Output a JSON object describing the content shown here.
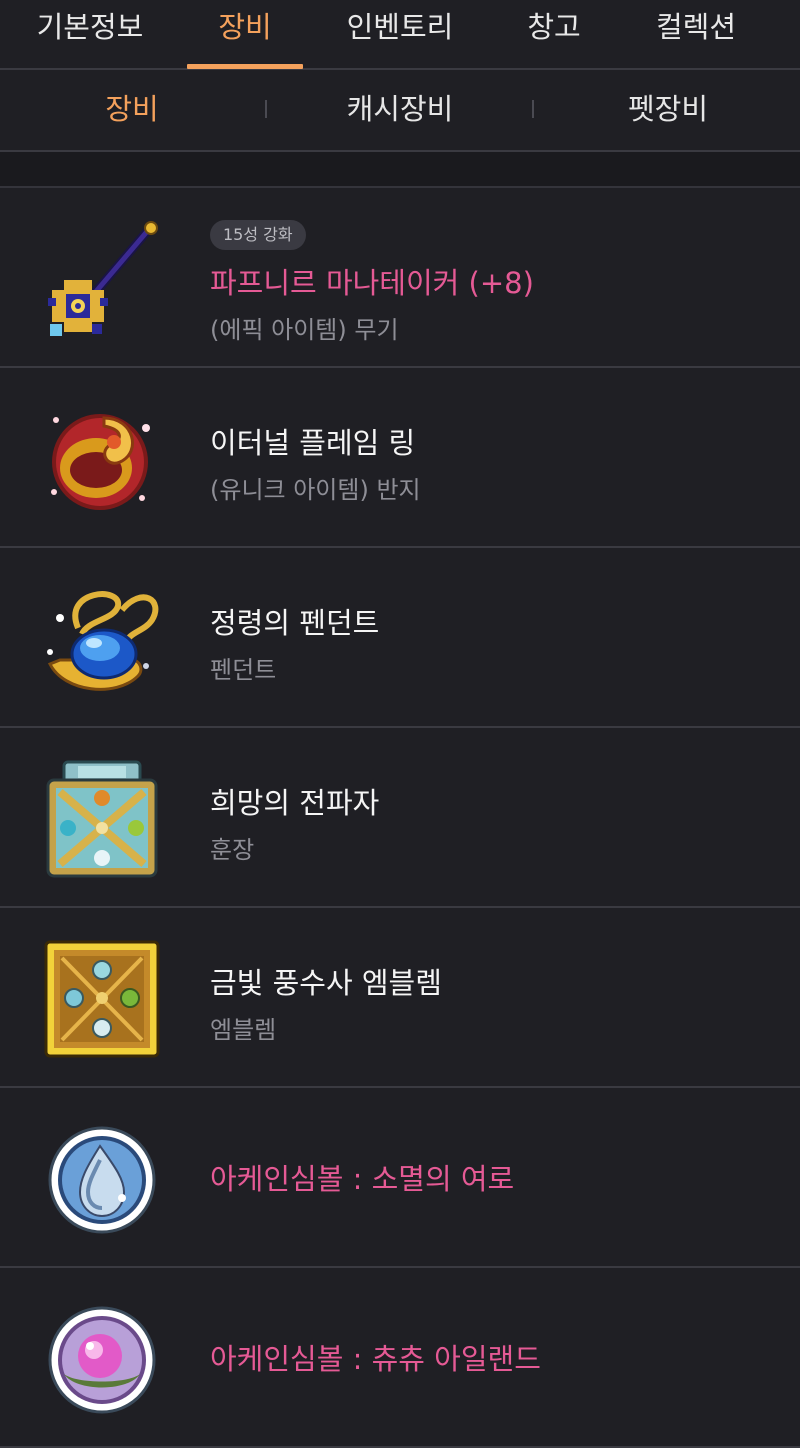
{
  "main_tabs": [
    {
      "label": "기본정보",
      "active": false
    },
    {
      "label": "장비",
      "active": true
    },
    {
      "label": "인벤토리",
      "active": false
    },
    {
      "label": "창고",
      "active": false
    },
    {
      "label": "컬렉션",
      "active": false
    }
  ],
  "sub_tabs": [
    {
      "label": "장비",
      "active": true
    },
    {
      "label": "캐시장비",
      "active": false
    },
    {
      "label": "펫장비",
      "active": false
    }
  ],
  "colors": {
    "accent": "#f4a15c",
    "epic_pink": "#e55a95",
    "background": "#1f1f24"
  },
  "items": [
    {
      "badge": "15성 강화",
      "name": "파프니르 마나테이커 (+8)",
      "sub": "(에픽 아이템) 무기",
      "icon": "staff-icon",
      "name_color": "pink"
    },
    {
      "name": "이터널 플레임 링",
      "sub": "(유니크 아이템) 반지",
      "icon": "flame-ring-icon",
      "name_color": "white"
    },
    {
      "name": "정령의 펜던트",
      "sub": "펜던트",
      "icon": "pendant-icon",
      "name_color": "white"
    },
    {
      "name": "희망의 전파자",
      "sub": "훈장",
      "icon": "medal-icon",
      "name_color": "white"
    },
    {
      "name": "금빛 풍수사 엠블렘",
      "sub": "엠블렘",
      "icon": "emblem-icon",
      "name_color": "white"
    },
    {
      "name": "아케인심볼 : 소멸의 여로",
      "icon": "arcane-symbol-vanishing-icon",
      "name_color": "pink"
    },
    {
      "name": "아케인심볼 : 츄츄 아일랜드",
      "icon": "arcane-symbol-chuchu-icon",
      "name_color": "pink"
    }
  ]
}
